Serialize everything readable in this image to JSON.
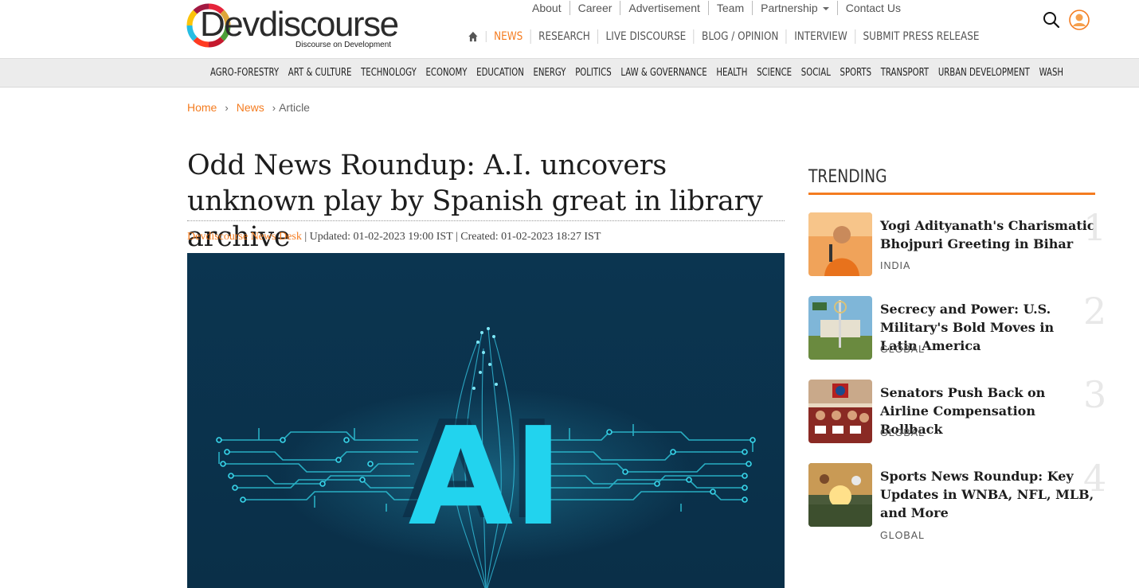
{
  "site": {
    "logo_text": "Devdiscourse",
    "tagline": "Discourse on Development"
  },
  "top_links": [
    "About",
    "Career",
    "Advertisement",
    "Team",
    "Partnership",
    "Contact Us"
  ],
  "main_nav": {
    "home_icon": "home-icon",
    "items": [
      "NEWS",
      "RESEARCH",
      "LIVE DISCOURSE",
      "BLOG / OPINION",
      "INTERVIEW",
      "SUBMIT PRESS RELEASE"
    ],
    "active": "NEWS"
  },
  "categories": [
    "AGRO-FORESTRY",
    "ART & CULTURE",
    "TECHNOLOGY",
    "ECONOMY",
    "EDUCATION",
    "ENERGY",
    "POLITICS",
    "LAW & GOVERNANCE",
    "HEALTH",
    "SCIENCE",
    "SOCIAL",
    "SPORTS",
    "TRANSPORT",
    "URBAN DEVELOPMENT",
    "WASH"
  ],
  "breadcrumb": {
    "home": "Home",
    "news": "News",
    "sep": "›",
    "current": "Article"
  },
  "article": {
    "title": "Odd News Roundup: A.I. uncovers unknown play by Spanish great in library archive",
    "author": "Devdiscourse News Desk",
    "meta": " | Updated: 01-02-2023 19:00 IST | Created: 01-02-2023 18:27 IST",
    "hero_text": "AI"
  },
  "trending": {
    "heading": "TRENDING",
    "items": [
      {
        "num": "1",
        "title": "Yogi Adityanath's Charismatic Bhojpuri Greeting in Bihar",
        "tag": "INDIA"
      },
      {
        "num": "2",
        "title": "Secrecy and Power: U.S. Military's Bold Moves in Latin America",
        "tag": "GLOBAL"
      },
      {
        "num": "3",
        "title": "Senators Push Back on Airline Compensation Rollback",
        "tag": "GLOBAL"
      },
      {
        "num": "4",
        "title": "Sports News Roundup: Key Updates in WNBA, NFL, MLB, and More",
        "tag": "GLOBAL"
      }
    ]
  },
  "colors": {
    "accent": "#f47c20",
    "hero_bg": "#0d3550",
    "hero_glow": "#22d3ee"
  }
}
